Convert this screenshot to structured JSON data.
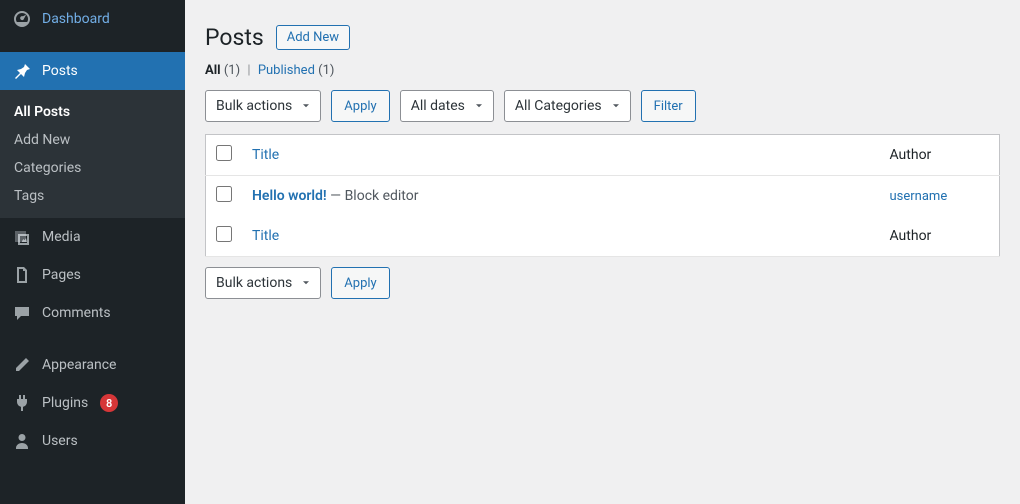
{
  "sidebar": {
    "dashboard": "Dashboard",
    "posts": "Posts",
    "posts_sub": {
      "all_posts": "All Posts",
      "add_new": "Add New",
      "categories": "Categories",
      "tags": "Tags"
    },
    "media": "Media",
    "pages": "Pages",
    "comments": "Comments",
    "appearance": "Appearance",
    "plugins": "Plugins",
    "plugins_badge": "8",
    "users": "Users"
  },
  "page": {
    "title": "Posts",
    "add_new": "Add New"
  },
  "filters": {
    "all_label": "All",
    "all_count": "(1)",
    "published_label": "Published",
    "published_count": "(1)",
    "bulk_actions": "Bulk actions",
    "apply": "Apply",
    "all_dates": "All dates",
    "all_categories": "All Categories",
    "filter": "Filter"
  },
  "table": {
    "col_title": "Title",
    "col_author": "Author",
    "rows": [
      {
        "title": "Hello world!",
        "state_sep": " — ",
        "state": "Block editor",
        "author": "username"
      }
    ]
  }
}
